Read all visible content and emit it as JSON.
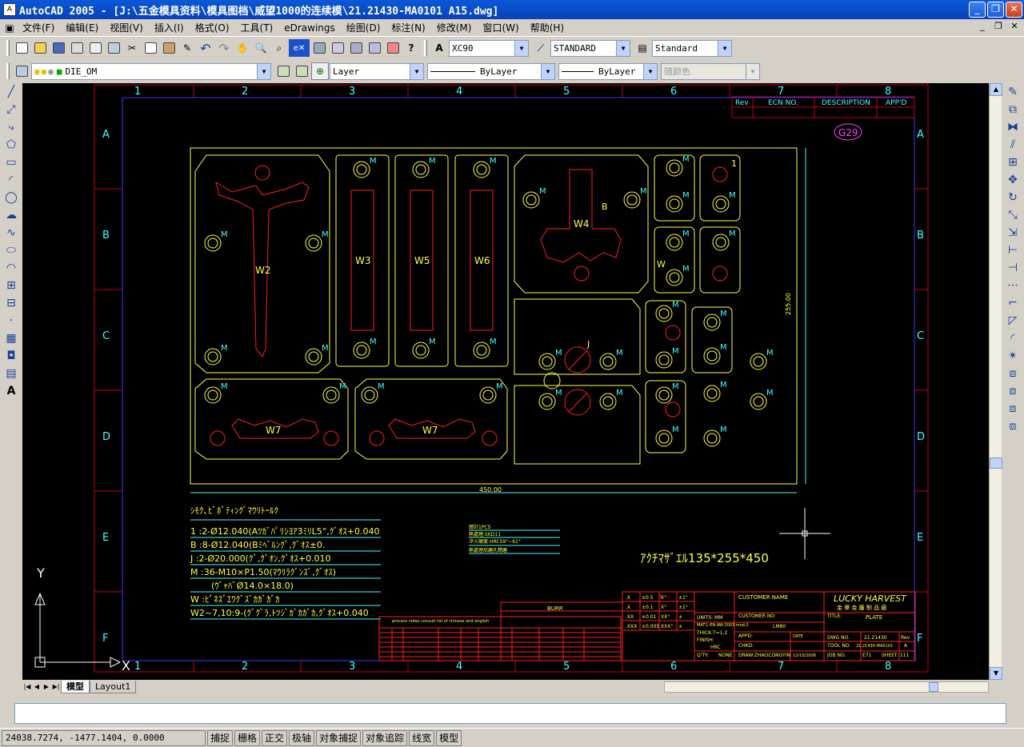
{
  "window": {
    "title": "AutoCAD 2005 - [J:\\五金模具资料\\模具图档\\威望1000的连续模\\21.21430-MA0101 A15.dwg]"
  },
  "menu": [
    "文件(F)",
    "编辑(E)",
    "视图(V)",
    "插入(I)",
    "格式(O)",
    "工具(T)",
    "eDrawings",
    "绘图(D)",
    "标注(N)",
    "修改(M)",
    "窗口(W)",
    "帮助(H)"
  ],
  "toolbar": {
    "textstyle": "XC90",
    "dimstyle": "STANDARD",
    "tablestyle": "Standard",
    "layer": "DIE_OM",
    "layer2": "Layer",
    "linetype": "ByLayer",
    "lineweight": "ByLayer",
    "color": "随颜色"
  },
  "drawing": {
    "cols": [
      "1",
      "2",
      "3",
      "4",
      "5",
      "6",
      "7",
      "8"
    ],
    "rows": [
      "A",
      "B",
      "C",
      "D",
      "E",
      "F"
    ],
    "rev_header": [
      "Rev",
      "ECN NO.",
      "DESCRIPTION",
      "APP'D"
    ],
    "revbadge": "G29",
    "dim_w": "450.00",
    "dim_h": "255.00",
    "parts": {
      "w2": "W2",
      "w3": "W3",
      "w5": "W5",
      "w6": "W6",
      "w4": "W4",
      "w7": "W7",
      "w": "W",
      "m": "M",
      "b": "B",
      "j": "J",
      "one": "1"
    },
    "notes_title": "ｼﾓｸ､ﾋﾞﾎﾞﾃｨﾝｸﾞﾏｳﾘﾄｰﾙｸ",
    "notes": [
      "1 :2-Ø12.040(Aﾂｶﾞﾊﾟﾘｼﾖｱ3ﾐﾘL5°,ｸﾞｵｽ+0.040",
      "B :8-Ø12.040(Bﾐﾍﾞﾙﾝｸﾞ,ｸﾞｵｽ±0.",
      "J :2-Ø20.000(ｸﾞ,ｸﾞｵﾝ,ｸﾞｵｽ+0.010",
      "M :36-M10×P1.50(ﾏｳﾘﾗｸﾞﾝｽﾞ,ｸﾞｵｽ)",
      "(ｳﾞｬﾊﾞØ14.0×18.0)",
      "W :ﾋﾟﾈｽﾞｴﾜｸﾞｽﾞｶｶﾞｶﾞｶ",
      "W2~7,10:9-(ｸﾞｸﾞﾗ,ﾄﾂｼﾞｶﾞｶｶﾞｶ,ｸﾞｵｽ+0.040"
    ],
    "mini": [
      "總計1PCS",
      "熱處理:SKD11",
      "淬火硬度:HRC59°~61°",
      "熱處理后磨孔精磨"
    ],
    "size_text": "ｱｸﾁﾏｻﾞｴﾙ135*255*450",
    "burr": "BURR",
    "process_title": "process notes consult list of chinese and english",
    "tb": {
      "customer_name": "CUSTOMER NAME",
      "company": "LUCKY HARVEST",
      "company_cn": "金 譽 金 屬 制 品 廠",
      "customer_no": "CUSTOMER NO:",
      "units": "UNITS: MM",
      "material": "MAT'L:EN AW-3003 mod.0",
      "material2": "LM80",
      "thick": "THICK:T=1.2",
      "finish": "FINISH:",
      "finish2": "HRC",
      "title_label": "TITLE:",
      "title_val": "PLATE",
      "appd": "APPD:",
      "chkd": "CHKD:",
      "drawn": "DRAW:ZHAOCONGYIN",
      "date_label": "DATE",
      "date_val": "12/10/2008",
      "qty": "Q'TY:",
      "qty_val": "NONE",
      "dwg_label": "DWG NO.",
      "dwg_val": "21.21430",
      "rev_label": "Rev",
      "tool_label": "TOOL NO.",
      "tool_val": "21.21430-MA0101",
      "tool_rev": "A",
      "job_label": "JOB NO.",
      "job_val": "E71",
      "sheet": "SHEET: 111"
    },
    "tol": [
      [
        ".X",
        "±0.5",
        "X°",
        "±1°"
      ],
      [
        ".X",
        "±0.1",
        "X°",
        "±1°"
      ],
      [
        ".XX",
        "±0.01",
        "XX°",
        "±"
      ],
      [
        ".XXX",
        "±0.005",
        "XXX°",
        "±"
      ]
    ]
  },
  "tabs": {
    "model": "模型",
    "layout1": "Layout1"
  },
  "status": {
    "coords": "24038.7274, -1477.1404, 0.0000",
    "buttons": [
      "捕捉",
      "栅格",
      "正交",
      "极轴",
      "对象捕捉",
      "对象追踪",
      "线宽",
      "模型"
    ]
  }
}
